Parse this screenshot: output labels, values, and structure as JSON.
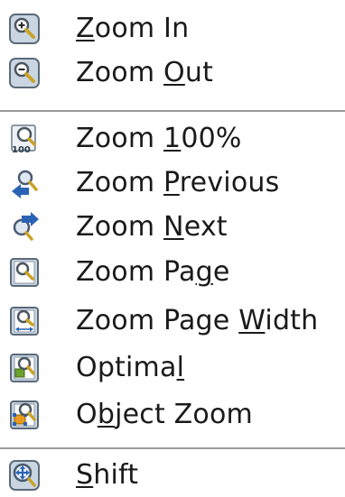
{
  "menu": {
    "items": [
      {
        "name": "zoom-in",
        "icon": "zoom-in-icon",
        "pre": "",
        "acc": "Z",
        "post": "oom In"
      },
      {
        "name": "zoom-out",
        "icon": "zoom-out-icon",
        "pre": "Zoom ",
        "acc": "O",
        "post": "ut"
      },
      {
        "name": "zoom-100",
        "icon": "zoom-100-icon",
        "pre": "Zoom ",
        "acc": "1",
        "post": "00%"
      },
      {
        "name": "zoom-previous",
        "icon": "zoom-previous-icon",
        "pre": "Zoom ",
        "acc": "P",
        "post": "revious"
      },
      {
        "name": "zoom-next",
        "icon": "zoom-next-icon",
        "pre": "Zoom ",
        "acc": "N",
        "post": "ext"
      },
      {
        "name": "zoom-page",
        "icon": "zoom-page-icon",
        "pre": "Zoom Pa",
        "acc": "g",
        "post": "e"
      },
      {
        "name": "zoom-page-width",
        "icon": "zoom-page-width-icon",
        "pre": "Zoom Page ",
        "acc": "W",
        "post": "idth"
      },
      {
        "name": "optimal",
        "icon": "optimal-zoom-icon",
        "pre": "Optima",
        "acc": "l",
        "post": ""
      },
      {
        "name": "object-zoom",
        "icon": "object-zoom-icon",
        "pre": "O",
        "acc": "b",
        "post": "ject Zoom"
      },
      {
        "name": "shift",
        "icon": "shift-icon",
        "pre": "",
        "acc": "S",
        "post": "hift"
      }
    ]
  },
  "colors": {
    "text": "#1a1a1a",
    "separator": "#9a9a9a",
    "icon_frame": "#5a6a78",
    "icon_fill": "#c9d6e2",
    "lens_handle": "#c9a227",
    "arrow_blue": "#2a62b6",
    "accent_green": "#6aa02c",
    "accent_orange": "#e89a1c"
  }
}
